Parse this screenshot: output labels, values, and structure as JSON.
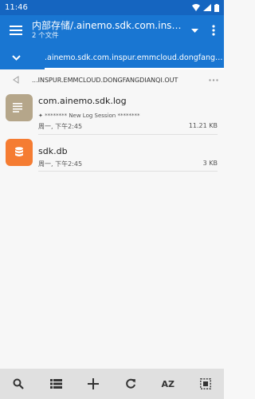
{
  "status": {
    "time": "11:46"
  },
  "appbar": {
    "title": "内部存储/.ainemo.sdk.com.inspur.emmcloud.dongfangdianqi.out",
    "subtitle": "2 个文件"
  },
  "tab": {
    "label": ".ainemo.sdk.com.inspur.emmcloud.dongfangdianqi.out"
  },
  "breadcrumb": {
    "path": "...INSPUR.EMMCLOUD.DONGFANGDIANQI.OUT"
  },
  "files": [
    {
      "name": "com.ainemo.sdk.log",
      "subtitle": "✦ ******** New Log Session ********",
      "date": "周一, 下午2:45",
      "size": "11.21 KB",
      "icon": "document-icon",
      "color": "#b5a68a"
    },
    {
      "name": "sdk.db",
      "subtitle": "",
      "date": "周一, 下午2:45",
      "size": "3 KB",
      "icon": "database-icon",
      "color": "#f57c32"
    }
  ],
  "toolbar": {
    "sort_label": "AZ"
  },
  "colors": {
    "primary": "#1976d2",
    "status": "#1565c0"
  }
}
